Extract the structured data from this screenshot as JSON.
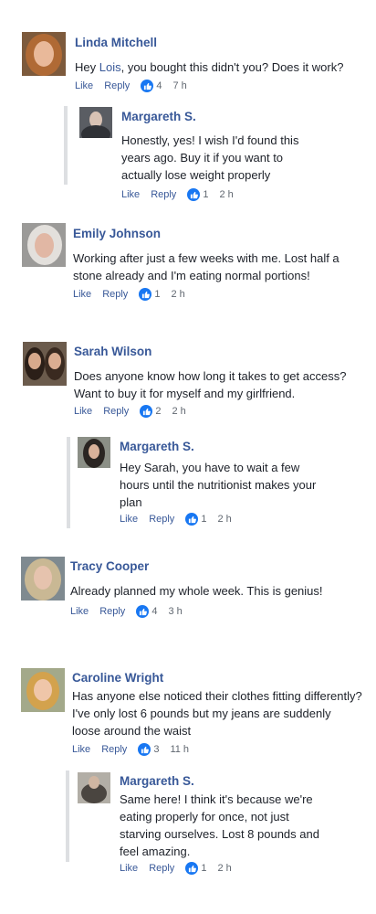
{
  "actions": {
    "like": "Like",
    "reply": "Reply"
  },
  "comments": [
    {
      "name": "Linda Mitchell",
      "text_pre": "Hey ",
      "mention": "Lois",
      "text_post": ", you bought this didn't you? Does it work?",
      "likes": "4",
      "time": "7 h",
      "reply": {
        "name": "Margareth S.",
        "text": "Honestly, yes! I wish I'd found this years ago. Buy it if you want to actually lose weight properly",
        "likes": "1",
        "time": "2 h"
      }
    },
    {
      "name": "Emily Johnson",
      "text": "Working after just a few weeks with me. Lost half a stone already and I'm eating normal portions!",
      "likes": "1",
      "time": "2 h"
    },
    {
      "name": "Sarah Wilson",
      "text": "Does anyone know how long it takes to get access? Want to buy it for myself and my girlfriend.",
      "likes": "2",
      "time": "2 h",
      "reply": {
        "name": "Margareth S.",
        "text": "Hey Sarah, you have to wait a few hours until the nutritionist makes your plan",
        "likes": "1",
        "time": "2 h"
      }
    },
    {
      "name": "Tracy Cooper",
      "text": "Already planned my whole week. This is genius!",
      "likes": "4",
      "time": "3 h"
    },
    {
      "name": "Caroline Wright",
      "text": "Has anyone else noticed their clothes fitting differently? I've only lost 6 pounds but my jeans are suddenly loose around the waist",
      "likes": "3",
      "time": "11 h",
      "reply": {
        "name": "Margareth S.",
        "text": "Same here! I think it's because we're eating properly for once, not just starving ourselves. Lost 8 pounds and feel amazing.",
        "likes": "1",
        "time": "2 h"
      }
    }
  ]
}
